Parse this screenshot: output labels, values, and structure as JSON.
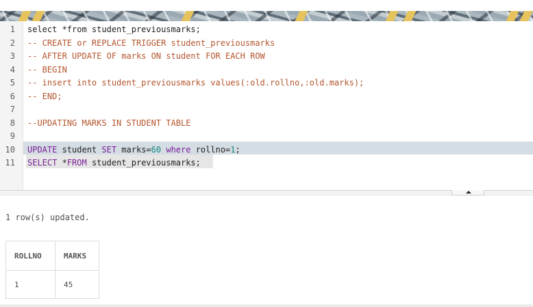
{
  "editor": {
    "line_numbers": [
      "1",
      "2",
      "3",
      "4",
      "5",
      "6",
      "7",
      "8",
      "9",
      "10",
      "11"
    ],
    "lines": [
      {
        "parts": [
          {
            "t": "select *from student_previousmarks;",
            "c": ""
          }
        ]
      },
      {
        "parts": [
          {
            "t": "-- CREATE or REPLACE TRIGGER student_previousmarks",
            "c": "cm"
          }
        ]
      },
      {
        "parts": [
          {
            "t": "-- AFTER UPDATE OF marks ON student FOR EACH ROW",
            "c": "cm"
          }
        ]
      },
      {
        "parts": [
          {
            "t": "-- BEGIN",
            "c": "cm"
          }
        ]
      },
      {
        "parts": [
          {
            "t": "-- insert into student_previousmarks values(:old.rollno,:old.marks);",
            "c": "cm"
          }
        ]
      },
      {
        "parts": [
          {
            "t": "-- END;",
            "c": "cm"
          }
        ]
      },
      {
        "parts": []
      },
      {
        "parts": [
          {
            "t": "--UPDATING MARKS IN STUDENT TABLE",
            "c": "cm"
          }
        ]
      },
      {
        "parts": []
      },
      {
        "parts": [
          {
            "t": "UPDATE",
            "c": "kw"
          },
          {
            "t": " student ",
            "c": ""
          },
          {
            "t": "SET",
            "c": "kw"
          },
          {
            "t": " marks=",
            "c": ""
          },
          {
            "t": "60",
            "c": "num"
          },
          {
            "t": " ",
            "c": ""
          },
          {
            "t": "where",
            "c": "kw"
          },
          {
            "t": " rollno=",
            "c": ""
          },
          {
            "t": "1",
            "c": "num"
          },
          {
            "t": ";",
            "c": ""
          }
        ]
      },
      {
        "parts": [
          {
            "t": "SELECT",
            "c": "kw"
          },
          {
            "t": " *",
            "c": ""
          },
          {
            "t": "FROM",
            "c": "kw"
          },
          {
            "t": " student_previousmarks;",
            "c": ""
          }
        ]
      }
    ],
    "active_line": 10,
    "selected_line": 11
  },
  "results": {
    "status": "1 row(s) updated.",
    "columns": [
      "ROLLNO",
      "MARKS"
    ],
    "rows": [
      [
        "1",
        "45"
      ]
    ]
  },
  "colors": {
    "keyword": "#7a1d98",
    "comment": "#b3542c",
    "number": "#12857c",
    "active_line": "#d5dde4"
  }
}
